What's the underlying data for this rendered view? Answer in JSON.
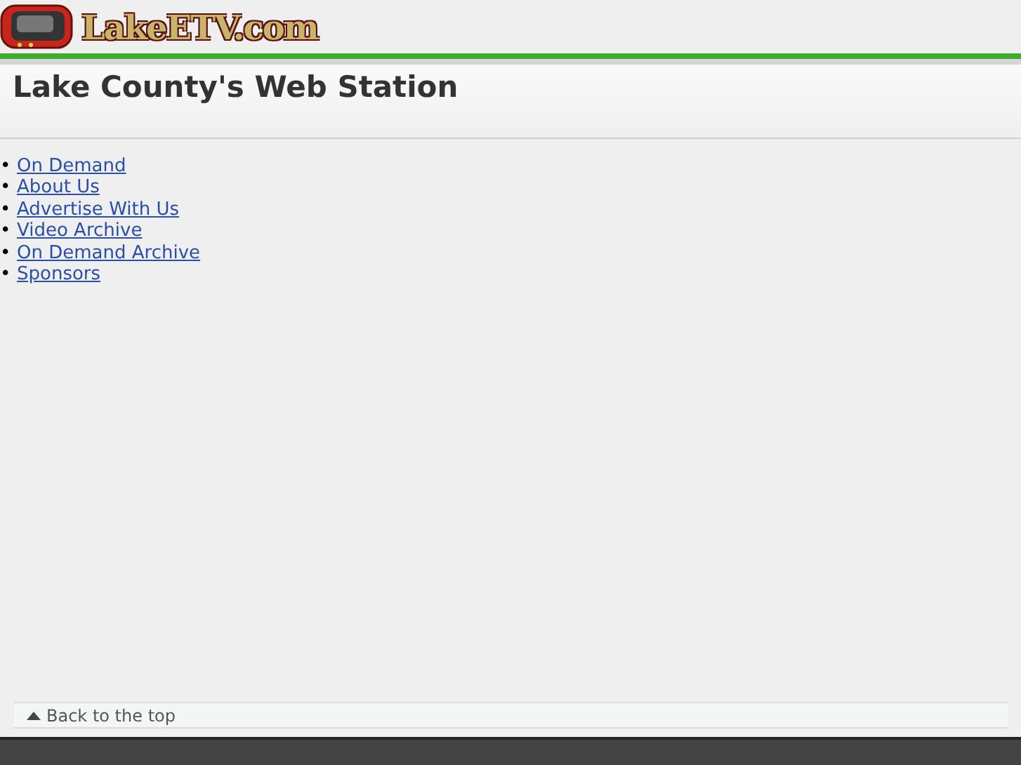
{
  "logo": {
    "text": "LakeETV.com"
  },
  "title": "Lake County's Web Station",
  "nav": [
    {
      "marker": "•",
      "label": "On Demand"
    },
    {
      "marker": "•",
      "label": "About Us"
    },
    {
      "marker": "•",
      "label": "Advertise With Us"
    },
    {
      "marker": "•",
      "label": "Video Archive"
    },
    {
      "marker": "•",
      "label": "On Demand Archive"
    },
    {
      "marker": "•",
      "label": "Sponsors"
    }
  ],
  "back_to_top": "Back to the top"
}
